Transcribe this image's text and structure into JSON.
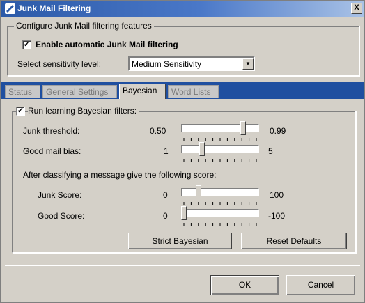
{
  "window": {
    "title": "Junk Mail Filtering",
    "close_label": "X"
  },
  "features": {
    "group_label": "Configure Junk Mail filtering features",
    "enable_label": "Enable automatic Junk Mail filtering",
    "enable_checked": true,
    "sensitivity_label": "Select sensitivity level:",
    "sensitivity_value": "Medium Sensitivity"
  },
  "tabs": [
    {
      "label": "Status",
      "active": false
    },
    {
      "label": "General Settings",
      "active": false
    },
    {
      "label": "Bayesian",
      "active": true
    },
    {
      "label": "Word Lists",
      "active": false
    }
  ],
  "bayesian": {
    "run_label": "Run learning Bayesian filters:",
    "run_checked": true,
    "junk_threshold": {
      "label": "Junk threshold:",
      "min": "0.50",
      "max": "0.99",
      "position": 0.82
    },
    "good_bias": {
      "label": "Good mail bias:",
      "min": "1",
      "max": "5",
      "position": 0.25
    },
    "classify_label": "After classifying a message give the following score:",
    "junk_score": {
      "label": "Junk Score:",
      "min": "0",
      "max": "100",
      "position": 0.2
    },
    "good_score": {
      "label": "Good Score:",
      "min": "0",
      "max": "-100",
      "position": 0.0
    },
    "strict_button": "Strict Bayesian",
    "reset_button": "Reset Defaults"
  },
  "footer": {
    "ok": "OK",
    "cancel": "Cancel"
  },
  "colors": {
    "title_start": "#2c5aa8",
    "tab_strip": "#1f4fa0",
    "face": "#d4d0c8"
  }
}
